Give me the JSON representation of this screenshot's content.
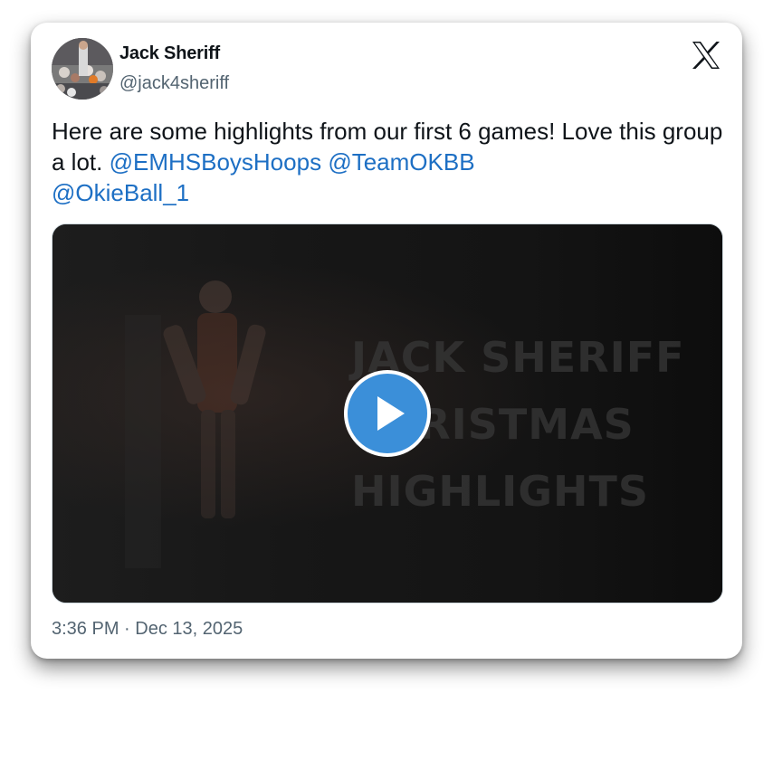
{
  "author": {
    "name": "Jack Sheriff",
    "handle": "@jack4sheriff",
    "avatar_icon": "profile-photo"
  },
  "brand": {
    "logo_icon": "x-logo"
  },
  "tweet": {
    "text_before": "Here are some highlights from our first 6 games! Love this group a lot. ",
    "mentions": [
      "@EMHSBoysHoops",
      "@TeamOKBB",
      "@OkieBall_1"
    ]
  },
  "media": {
    "type": "video",
    "overlay_line1": "JACK SHERIFF",
    "overlay_line2": "CHRISTMAS",
    "overlay_line3": "HIGHLIGHTS",
    "play_icon": "play-icon",
    "accent_color": "#3b8fd9"
  },
  "meta": {
    "timestamp": "3:36 PM · Dec 13, 2025"
  },
  "colors": {
    "text": "#0f1419",
    "secondary": "#536471",
    "link": "#1d6fc4"
  }
}
